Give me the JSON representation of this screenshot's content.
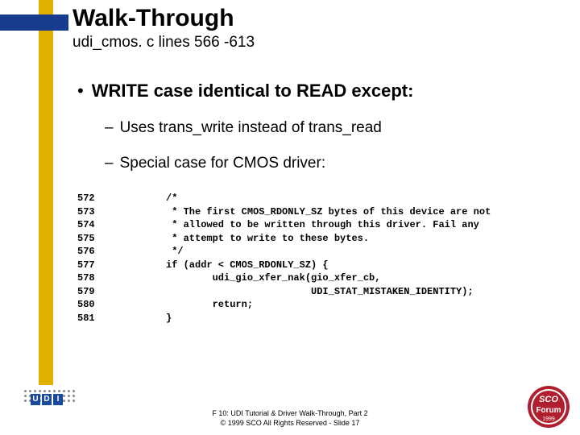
{
  "title": "Walk-Through",
  "subtitle": "udi_cmos. c lines 566 -613",
  "bullet_main": "WRITE case identical to READ except:",
  "sub_bullets": [
    "Uses trans_write instead of trans_read",
    "Special case for CMOS driver:"
  ],
  "code": {
    "line_numbers": "572\n573\n574\n575\n576\n577\n578\n579\n580\n581",
    "lines": "/*\n * The first CMOS_RDONLY_SZ bytes of this device are not\n * allowed to be written through this driver. Fail any\n * attempt to write to these bytes.\n */\nif (addr < CMOS_RDONLY_SZ) {\n        udi_gio_xfer_nak(gio_xfer_cb,\n                         UDI_STAT_MISTAKEN_IDENTITY);\n        return;\n}"
  },
  "footer": {
    "line1": "F 10: UDI Tutorial & Driver Walk-Through, Part 2",
    "line2": "© 1999 SCO  All Rights Reserved - Slide 17"
  },
  "logos": {
    "left_label": "UDI",
    "right_top": "SCO",
    "right_bottom": "Forum",
    "right_year": "1999"
  },
  "colors": {
    "accent_blue": "#163b8f",
    "gold": "#e0b000",
    "sco_red": "#b11e2e"
  }
}
